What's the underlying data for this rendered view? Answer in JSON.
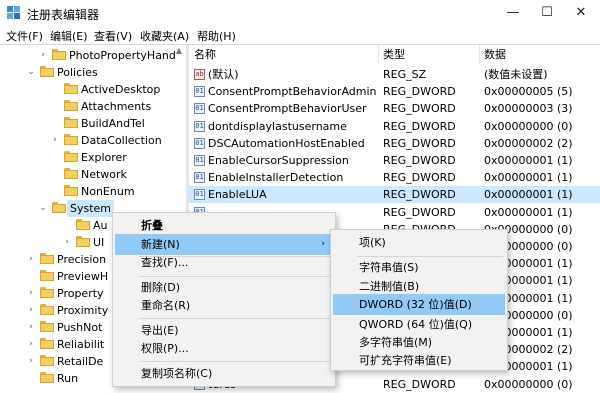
{
  "window": {
    "title": "注册表编辑器",
    "minimize": "—",
    "maximize": "☐",
    "close": "✕"
  },
  "menubar": [
    "文件(F)",
    "编辑(E)",
    "查看(V)",
    "收藏夹(A)",
    "帮助(H)"
  ],
  "tree": {
    "items": [
      {
        "label": "PhotoPropertyHand",
        "expander": "›",
        "level": 2
      },
      {
        "label": "Policies",
        "expander": "⌄",
        "level": 1
      },
      {
        "label": "ActiveDesktop",
        "expander": "",
        "level": 3
      },
      {
        "label": "Attachments",
        "expander": "",
        "level": 3
      },
      {
        "label": "BuildAndTel",
        "expander": "",
        "level": 3
      },
      {
        "label": "DataCollection",
        "expander": "›",
        "level": 3
      },
      {
        "label": "Explorer",
        "expander": "",
        "level": 3
      },
      {
        "label": "Network",
        "expander": "",
        "level": 3
      },
      {
        "label": "NonEnum",
        "expander": "",
        "level": 3
      },
      {
        "label": "System",
        "expander": "⌄",
        "level": 2,
        "selected": true
      },
      {
        "label": "Au",
        "expander": "",
        "level": 4
      },
      {
        "label": "UI",
        "expander": "›",
        "level": 4
      },
      {
        "label": "Precision",
        "expander": "›",
        "level": 1
      },
      {
        "label": "PreviewH",
        "expander": "",
        "level": 1
      },
      {
        "label": "Property",
        "expander": "›",
        "level": 1
      },
      {
        "label": "Proximity",
        "expander": "›",
        "level": 1
      },
      {
        "label": "PushNot",
        "expander": "›",
        "level": 1
      },
      {
        "label": "Reliabilit",
        "expander": "›",
        "level": 1
      },
      {
        "label": "RetailDe",
        "expander": "›",
        "level": 1
      },
      {
        "label": "Run",
        "expander": "",
        "level": 1
      }
    ]
  },
  "list": {
    "headers": {
      "name": "名称",
      "type": "类型",
      "data": "数据"
    },
    "rows": [
      {
        "icon": "ab",
        "name": "(默认)",
        "type": "REG_SZ",
        "data": "(数值未设置)"
      },
      {
        "icon": "01",
        "name": "ConsentPromptBehaviorAdmin",
        "type": "REG_DWORD",
        "data": "0x00000005 (5)"
      },
      {
        "icon": "01",
        "name": "ConsentPromptBehaviorUser",
        "type": "REG_DWORD",
        "data": "0x00000003 (3)"
      },
      {
        "icon": "01",
        "name": "dontdisplaylastusername",
        "type": "REG_DWORD",
        "data": "0x00000000 (0)"
      },
      {
        "icon": "01",
        "name": "DSCAutomationHostEnabled",
        "type": "REG_DWORD",
        "data": "0x00000002 (2)"
      },
      {
        "icon": "01",
        "name": "EnableCursorSuppression",
        "type": "REG_DWORD",
        "data": "0x00000001 (1)"
      },
      {
        "icon": "01",
        "name": "EnableInstallerDetection",
        "type": "REG_DWORD",
        "data": "0x00000001 (1)"
      },
      {
        "icon": "01",
        "name": "EnableLUA",
        "type": "REG_DWORD",
        "data": "0x00000001 (1)",
        "selected": true
      },
      {
        "icon": "01",
        "name": "",
        "type": "REG_DWORD",
        "data": "0x00000001 (1)"
      },
      {
        "icon": "01",
        "name": "",
        "type": "REG_DWORD",
        "data": "0x00000000 (0)"
      },
      {
        "icon": "",
        "name": "",
        "type": "",
        "data": "0x00000000 (0)"
      },
      {
        "icon": "",
        "name": "",
        "type": "",
        "data": "0x00000001 (1)"
      },
      {
        "icon": "",
        "name": "",
        "type": "",
        "data": "0x00000001 (1)"
      },
      {
        "icon": "",
        "name": "",
        "type": "",
        "data": "0x00000001 (1)"
      },
      {
        "icon": "",
        "name": "",
        "type": "",
        "data": "0x00000000 (0)"
      },
      {
        "icon": "",
        "name": "",
        "type": "",
        "data": "0x00000001 (1)"
      },
      {
        "icon": "",
        "name": "",
        "type": "",
        "data": "0x00000002 (2)"
      },
      {
        "icon": "",
        "name": "",
        "type": "",
        "data": "0x00000001 (1)"
      },
      {
        "icon": "01",
        "name": "tures",
        "type": "REG_DWORD",
        "data": "0x00000000 (0)"
      }
    ]
  },
  "context_menu": {
    "items": [
      "折叠",
      "新建(N)",
      "查找(F)...",
      "删除(D)",
      "重命名(R)",
      "导出(E)",
      "权限(P)...",
      "复制项名称(C)"
    ],
    "submenu_arrow": "›"
  },
  "submenu": {
    "items": [
      "项(K)",
      "字符串值(S)",
      "二进制值(B)",
      "DWORD (32 位)值(D)",
      "QWORD (64 位)值(Q)",
      "多字符串值(M)",
      "可扩充字符串值(E)"
    ]
  }
}
